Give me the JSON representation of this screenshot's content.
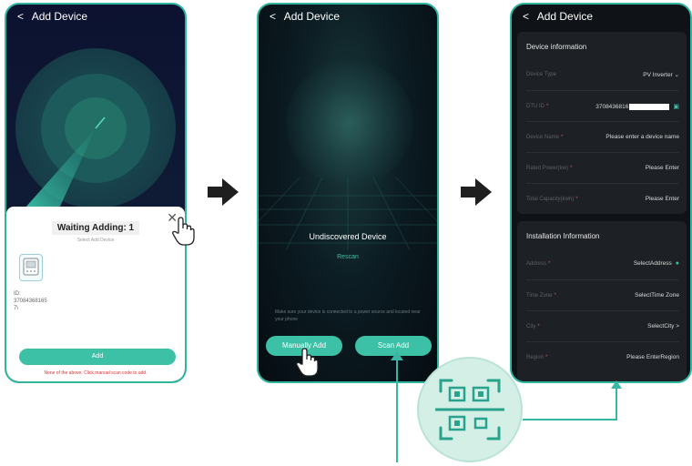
{
  "screen1": {
    "header_title": "Add Device",
    "back_glyph": "<",
    "waiting_title": "Waiting Adding:  1",
    "select_hint": "Select Add Device",
    "device_id_label": "ID:",
    "device_id_value": "37084368165",
    "device_id_tail": "7\\",
    "add_label": "Add",
    "note": "None of the above, Click manual scan code to add.",
    "close_glyph": "✕"
  },
  "screen2": {
    "header_title": "Add Device",
    "back_glyph": "<",
    "undiscovered": "Undiscovered Device",
    "rescan": "Rescan",
    "tip": "Make sure your device is connected to a power source and located near your phone",
    "manual_add": "Manually Add",
    "scan_add": "Scan Add"
  },
  "screen3": {
    "header_title": "Add Device",
    "back_glyph": "<",
    "device_info_title": "Device information",
    "device_rows": [
      {
        "label": "Device Type",
        "required": "",
        "value": "PV Inverter  ⌄"
      },
      {
        "label": "DTU ID",
        "required": "*",
        "value": "3708436816"
      },
      {
        "label": "Device Name",
        "required": "*",
        "value": "Please enter a device name"
      },
      {
        "label": "Rated Power(kw)",
        "required": "*",
        "value": "Please Enter"
      },
      {
        "label": "Total Capacity(kwh)",
        "required": "*",
        "value": "Please Enter"
      }
    ],
    "install_title": "Installation Information",
    "install_rows": [
      {
        "label": "Address",
        "required": "*",
        "value": "SelectAddress"
      },
      {
        "label": "Time Zone",
        "required": "*",
        "value": "SelectTime Zone"
      },
      {
        "label": "City",
        "required": "*",
        "value": "SelectCity  >"
      },
      {
        "label": "Region",
        "required": "*",
        "value": "Please EnterRegion"
      }
    ]
  },
  "colors": {
    "accent": "#3cc0a6",
    "border": "#2fb5a0",
    "danger": "#e03030"
  },
  "icons": {
    "arrow": "right-arrow-icon",
    "hand": "tap-hand-icon",
    "qr": "qr-scan-icon",
    "location": "location-pin-icon",
    "scan_small": "scan-small-icon"
  }
}
